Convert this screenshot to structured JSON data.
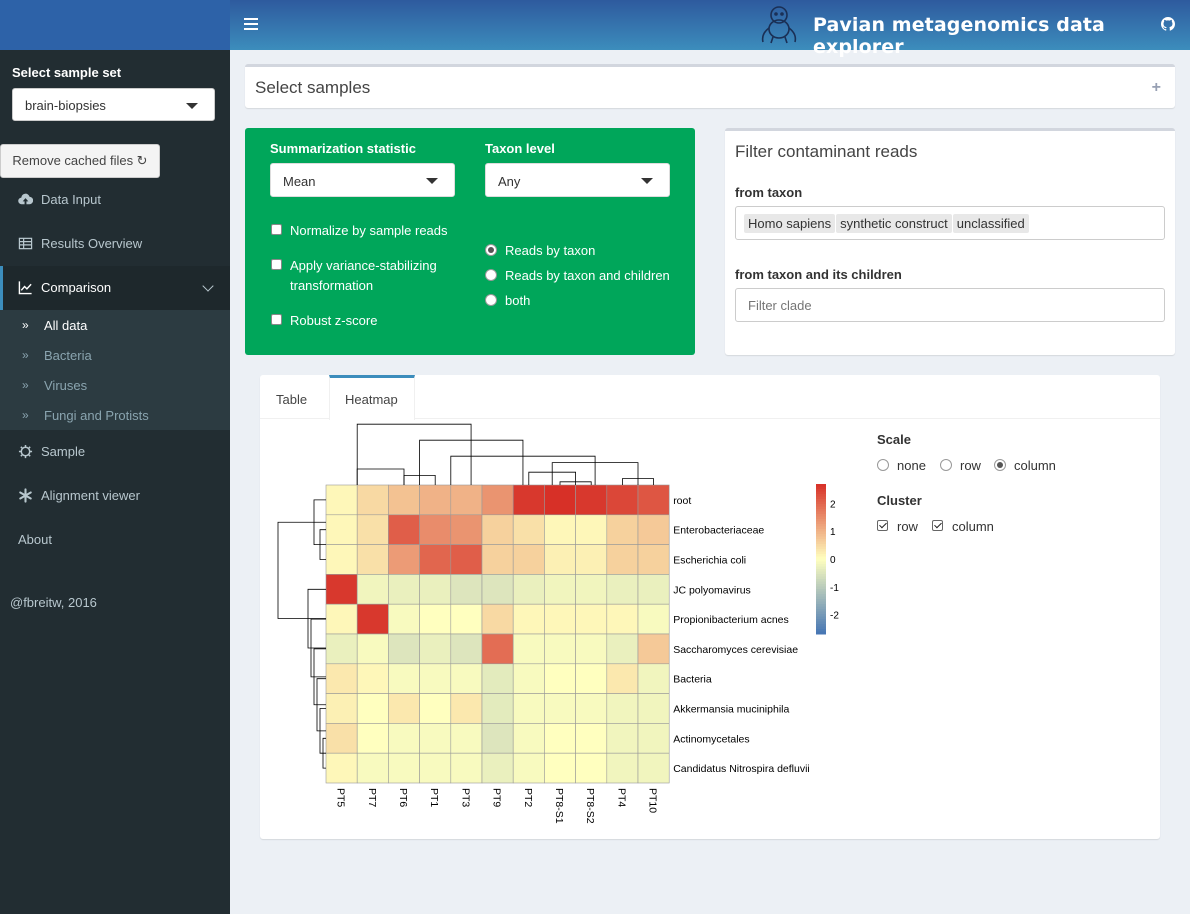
{
  "header": {
    "title": "Pavian metagenomics data explorer"
  },
  "sidebar": {
    "sample_set_label": "Select sample set",
    "sample_set_value": "brain-biopsies",
    "remove_cached_label": "Remove cached files ↻",
    "items": [
      {
        "label": "Data Input",
        "icon": "cloud-upload-icon"
      },
      {
        "label": "Results Overview",
        "icon": "table-icon"
      },
      {
        "label": "Comparison",
        "icon": "line-chart-icon"
      },
      {
        "label": "Sample",
        "icon": "gear-icon"
      },
      {
        "label": "Alignment viewer",
        "icon": "asterisk-icon"
      },
      {
        "label": "About",
        "icon": ""
      }
    ],
    "submenu": [
      {
        "label": "All data"
      },
      {
        "label": "Bacteria"
      },
      {
        "label": "Viruses"
      },
      {
        "label": "Fungi and Protists"
      }
    ],
    "credit": "@fbreitw, 2016"
  },
  "select_samples": {
    "title": "Select samples",
    "toggle": "+"
  },
  "options": {
    "summarization_label": "Summarization statistic",
    "summarization_value": "Mean",
    "taxon_level_label": "Taxon level",
    "taxon_level_value": "Any",
    "normalize": "Normalize by sample reads",
    "variance_line1": "Apply variance-stabilizing",
    "variance_line2": "transformation",
    "zscore": "Robust z-score",
    "reads_taxon": "Reads by taxon",
    "reads_children": "Reads by taxon and children",
    "both": "both"
  },
  "filter": {
    "title": "Filter contaminant reads",
    "from_taxon_label": "from taxon",
    "tags": [
      "Homo sapiens",
      "synthetic construct",
      "unclassified"
    ],
    "from_children_label": "from taxon and its children",
    "clade_placeholder": "Filter clade"
  },
  "tabs": {
    "table": "Table",
    "heatmap": "Heatmap"
  },
  "heatmap_options": {
    "scale_label": "Scale",
    "scale_options": [
      "none",
      "row",
      "column"
    ],
    "scale_selected": "column",
    "cluster_label": "Cluster",
    "cluster_row": "row",
    "cluster_column": "column"
  },
  "chart_data": {
    "type": "heatmap",
    "columns": [
      "PT5",
      "PT7",
      "PT6",
      "PT1",
      "PT3",
      "PT9",
      "PT2",
      "PT8-S1",
      "PT8-S2",
      "PT4",
      "PT10"
    ],
    "rows": [
      "root",
      "Enterobacteriaceae",
      "Escherichia coli",
      "JC polyomavirus",
      "Propionibacterium acnes",
      "Saccharomyces cerevisiae",
      "Bacteria",
      "Akkermansia muciniphila",
      "Actinomycetales",
      "Candidatus Nitrospira defluvii"
    ],
    "values": [
      [
        0.1,
        0.5,
        0.8,
        1.0,
        1.0,
        1.4,
        2.6,
        2.7,
        2.6,
        2.4,
        2.2
      ],
      [
        0.1,
        0.4,
        2.1,
        1.5,
        1.4,
        0.6,
        0.4,
        0.1,
        0.1,
        0.6,
        0.7
      ],
      [
        0.1,
        0.4,
        1.3,
        2.0,
        2.1,
        0.6,
        0.6,
        0.2,
        0.2,
        0.6,
        0.6
      ],
      [
        2.6,
        -0.2,
        -0.3,
        -0.3,
        -0.5,
        -0.5,
        -0.3,
        -0.2,
        -0.2,
        -0.3,
        -0.3
      ],
      [
        0.1,
        2.6,
        -0.1,
        0.0,
        0.0,
        0.5,
        0.1,
        0.1,
        0.1,
        0.1,
        -0.1
      ],
      [
        -0.3,
        -0.1,
        -0.5,
        -0.3,
        -0.5,
        1.9,
        -0.1,
        -0.1,
        -0.1,
        -0.3,
        0.7
      ],
      [
        0.3,
        0.1,
        -0.1,
        -0.1,
        -0.1,
        -0.4,
        -0.1,
        0.0,
        0.0,
        0.3,
        -0.2
      ],
      [
        0.2,
        0.0,
        0.3,
        0.0,
        0.3,
        -0.4,
        -0.1,
        -0.1,
        -0.1,
        -0.2,
        -0.2
      ],
      [
        0.4,
        0.0,
        -0.1,
        -0.1,
        -0.1,
        -0.5,
        -0.1,
        0.0,
        0.0,
        -0.2,
        -0.2
      ],
      [
        0.1,
        -0.1,
        -0.1,
        -0.1,
        -0.1,
        -0.3,
        -0.1,
        0.0,
        0.0,
        -0.2,
        -0.2
      ]
    ],
    "colorbar": {
      "min": -2.7,
      "max": 2.7,
      "ticks": [
        2,
        1,
        0,
        -1,
        -2
      ]
    },
    "colors": {
      "high": "#d73027",
      "mid": "#ffffbf",
      "low": "#4575b4"
    }
  },
  "colors": {
    "header": "#3c8dbc",
    "sidebar": "#222d32",
    "options_box": "#00a65a"
  }
}
